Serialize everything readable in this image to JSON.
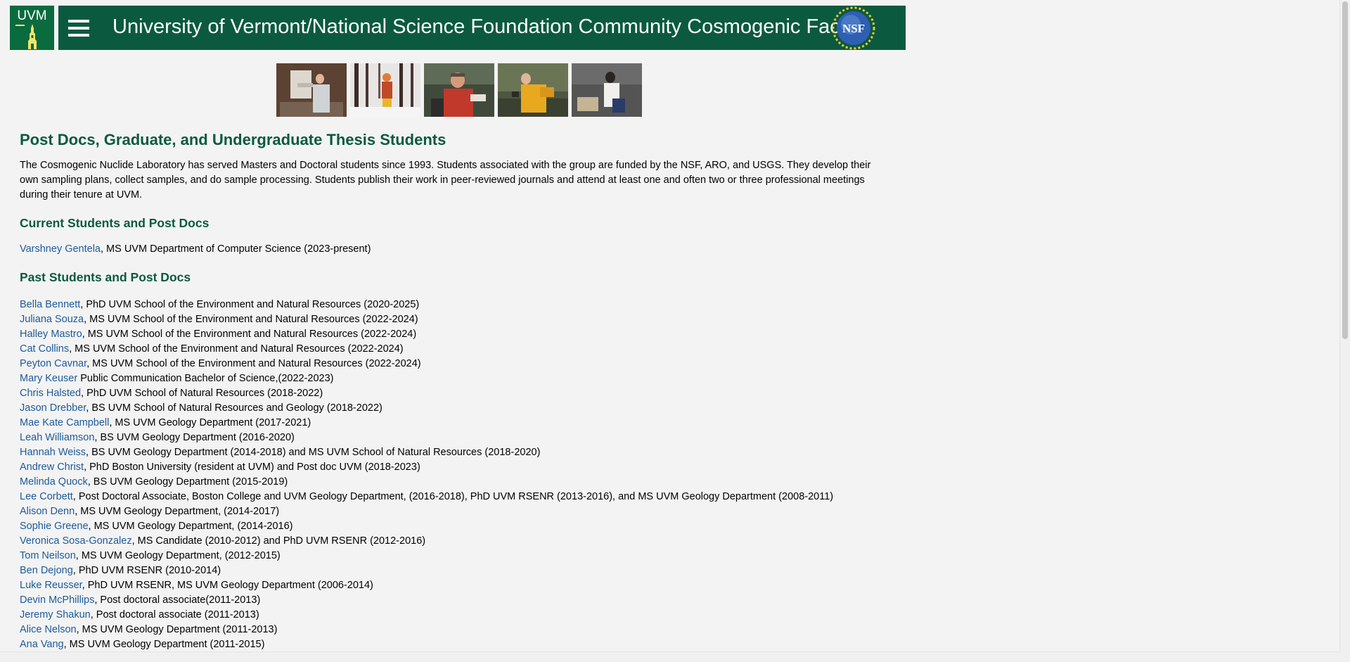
{
  "header": {
    "logo_text": "UVM",
    "title": "University of Vermont/National Science Foundation Community Cosmogenic Facility",
    "nsf_text": "NSF"
  },
  "photos": [
    {
      "name": "photo-lab-worker"
    },
    {
      "name": "photo-snow-sampling"
    },
    {
      "name": "photo-field-researcher"
    },
    {
      "name": "photo-yellow-jacket"
    },
    {
      "name": "photo-lab-notebook"
    }
  ],
  "content": {
    "title": "Post Docs, Graduate, and Undergraduate Thesis Students",
    "intro": "The Cosmogenic Nuclide Laboratory has served Masters and Doctoral students since 1993. Students associated with the group are funded by the NSF, ARO, and USGS. They develop their own sampling plans, collect samples, and do sample processing. Students publish their work in peer-reviewed journals and attend at least one and often two or three professional meetings during their tenure at UVM.",
    "current_heading": "Current Students and Post Docs",
    "current": [
      {
        "name": "Varshney Gentela",
        "desc": ", MS UVM Department of Computer Science (2023-present)"
      }
    ],
    "past_heading": "Past Students and Post Docs",
    "past": [
      {
        "name": "Bella Bennett",
        "desc": ", PhD UVM School of the Environment and Natural Resources (2020-2025)"
      },
      {
        "name": "Juliana Souza",
        "desc": ", MS UVM School of the Environment and Natural Resources (2022-2024)"
      },
      {
        "name": "Halley Mastro",
        "desc": ", MS UVM School of the Environment and Natural Resources (2022-2024)"
      },
      {
        "name": "Cat Collins",
        "desc": ", MS UVM School of the Environment and Natural Resources (2022-2024)"
      },
      {
        "name": "Peyton Cavnar",
        "desc": ", MS UVM School of the Environment and Natural Resources (2022-2024)"
      },
      {
        "name": "Mary Keuser",
        "desc": " Public Communication Bachelor of Science,(2022-2023)"
      },
      {
        "name": "Chris Halsted",
        "desc": ", PhD UVM School of Natural Resources (2018-2022)"
      },
      {
        "name": "Jason Drebber",
        "desc": ", BS UVM School of Natural Resources and Geology (2018-2022)"
      },
      {
        "name": "Mae Kate Campbell",
        "desc": ", MS UVM Geology Department (2017-2021)"
      },
      {
        "name": "Leah Williamson",
        "desc": ", BS UVM Geology Department (2016-2020)"
      },
      {
        "name": "Hannah Weiss",
        "desc": ", BS UVM Geology Department (2014-2018) and MS UVM School of Natural Resources (2018-2020)"
      },
      {
        "name": "Andrew Christ",
        "desc": ", PhD Boston University (resident at UVM) and Post doc UVM (2018-2023)"
      },
      {
        "name": "Melinda Quock",
        "desc": ", BS UVM Geology Department (2015-2019)"
      },
      {
        "name": "Lee Corbett",
        "desc": ", Post Doctoral Associate, Boston College and UVM Geology Department, (2016-2018), PhD UVM RSENR (2013-2016), and MS UVM Geology Department (2008-2011)"
      },
      {
        "name": "Alison Denn",
        "desc": ", MS UVM Geology Department, (2014-2017)"
      },
      {
        "name": "Sophie Greene",
        "desc": ", MS UVM Geology Department, (2014-2016)"
      },
      {
        "name": "Veronica Sosa-Gonzalez",
        "desc": ", MS Candidate (2010-2012) and PhD UVM RSENR (2012-2016)"
      },
      {
        "name": "Tom Neilson",
        "desc": ", MS UVM Geology Department, (2012-2015)"
      },
      {
        "name": "Ben Dejong",
        "desc": ", PhD UVM RSENR (2010-2014)"
      },
      {
        "name": "Luke Reusser",
        "desc": ", PhD UVM RSENR, MS UVM Geology Department (2006-2014)"
      },
      {
        "name": "Devin McPhillips",
        "desc": ", Post doctoral associate(2011-2013)"
      },
      {
        "name": "Jeremy Shakun",
        "desc": ", Post doctoral associate (2011-2013)"
      },
      {
        "name": "Alice Nelson",
        "desc": ", MS UVM Geology Department (2011-2013)"
      },
      {
        "name": "Ana Vang",
        "desc": ", MS UVM Geology Department (2011-2015)"
      }
    ]
  },
  "colors": {
    "banner": "#0b5a3f",
    "heading": "#0b5a3f",
    "link": "#1d5a9a",
    "background": "#f3f3f3"
  }
}
